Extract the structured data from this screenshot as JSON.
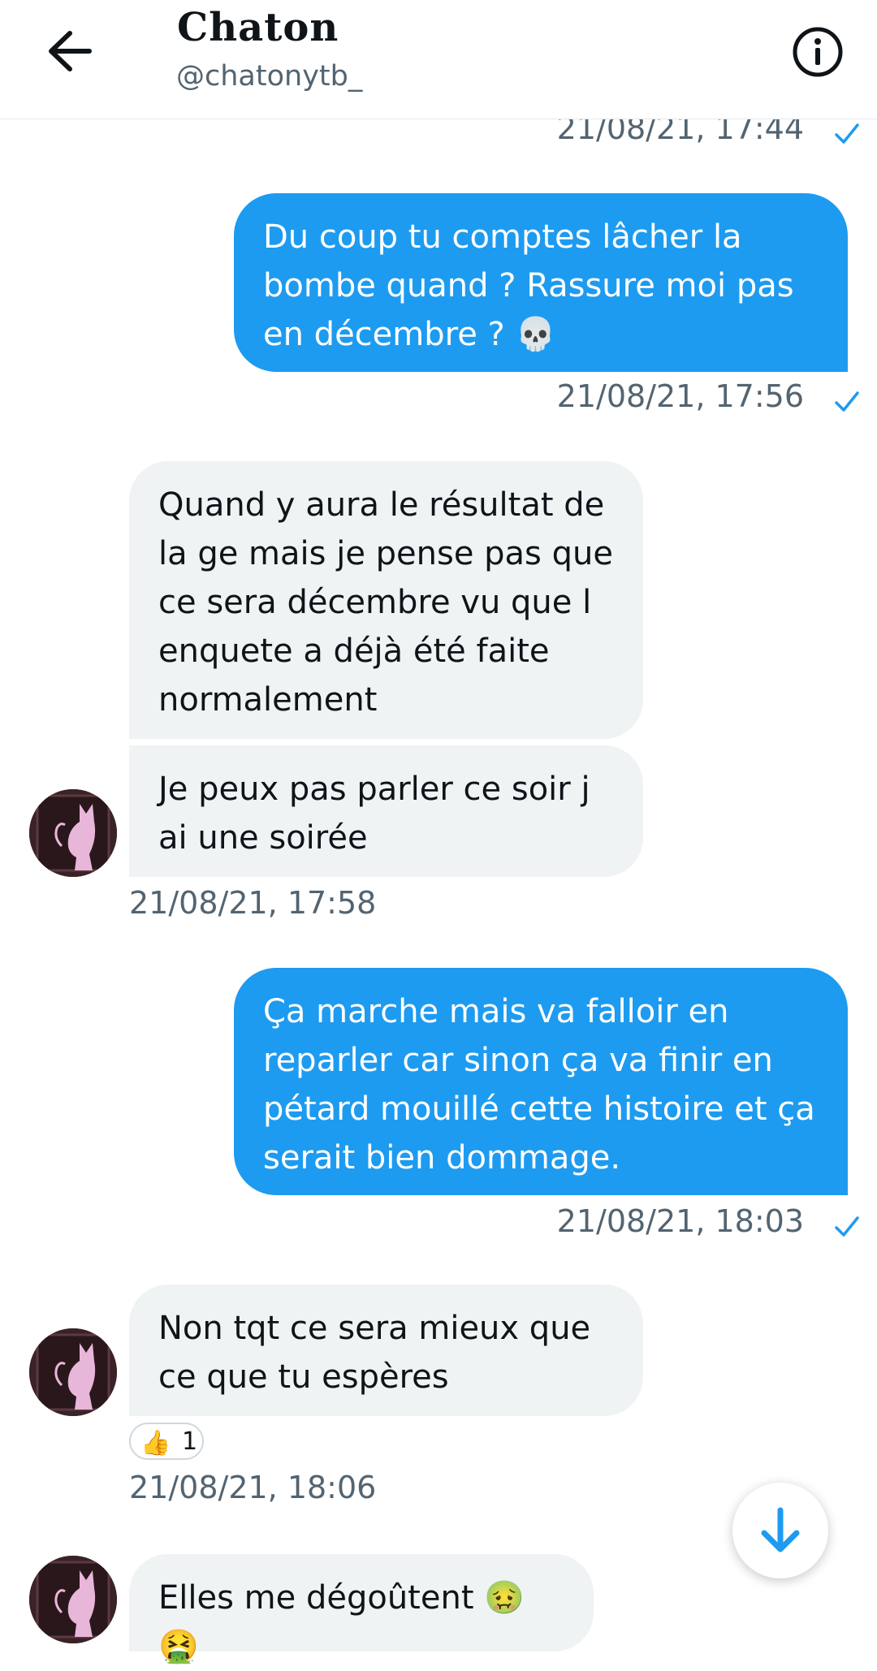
{
  "header": {
    "title": "Chaton",
    "handle": "@chatonytb_"
  },
  "messages": {
    "ts_top": "21/08/21, 17:44",
    "m1": "Du coup tu comptes lâcher la bombe quand ? Rassure moi pas en décembre ? 💀",
    "ts_m1": "21/08/21, 17:56",
    "m2": "Quand y aura le résultat de la ge mais je pense pas que ce sera décembre vu que l enquete a déjà été faite normalement",
    "m3": "Je peux pas parler ce soir j ai une soirée",
    "ts_m3": "21/08/21, 17:58",
    "m4": "Ça marche mais va falloir en reparler car sinon ça va finir en pétard mouillé cette histoire et ça serait bien dommage.",
    "ts_m4": "21/08/21, 18:03",
    "m5": "Non tqt ce sera mieux que ce que tu espères",
    "reaction_emoji": "👍",
    "reaction_count": "1",
    "ts_m5": "21/08/21, 18:06",
    "m6": "Elles me dégoûtent 🤢🤮"
  },
  "colors": {
    "accent": "#1d9bf0",
    "incoming_bubble": "#eff3f4",
    "timestamp": "#536471"
  },
  "icons": [
    "back-arrow-icon",
    "info-icon",
    "read-check-icon",
    "scroll-down-arrow-icon"
  ]
}
